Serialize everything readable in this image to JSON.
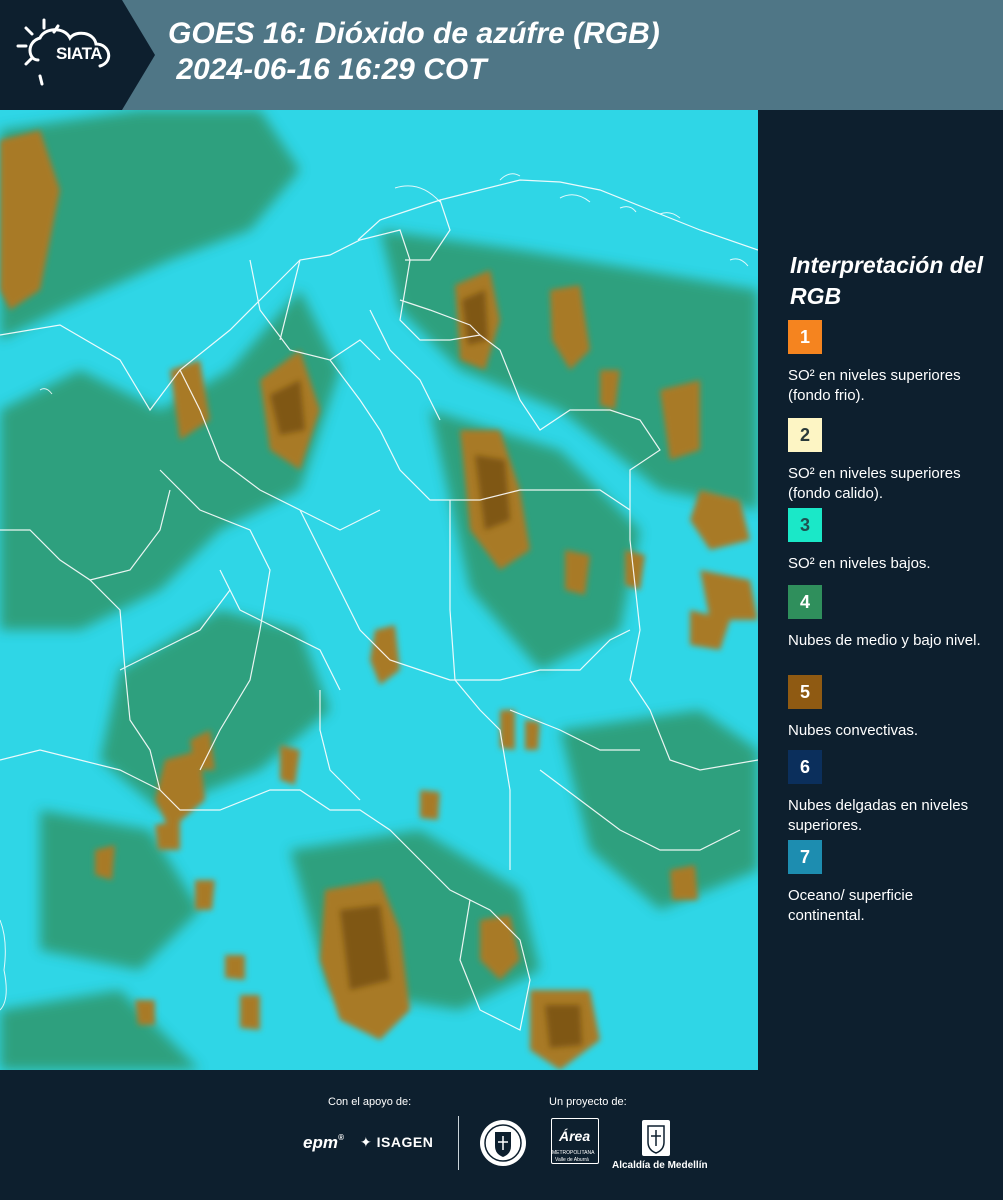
{
  "header": {
    "logo_text": "SIATA",
    "title_line1": "GOES 16: Dióxido de azúfre (RGB)",
    "title_line2": " 2024-06-16 16:29 COT"
  },
  "map": {
    "background_color": "#2fd6e6",
    "border_color": "#ffffff"
  },
  "legend": {
    "title": "Interpretación del RGB",
    "items": [
      {
        "number": "1",
        "label": "SO² en niveles superiores (fondo frio).",
        "color": "#f5841f",
        "number_color": "#ffffff"
      },
      {
        "number": "2",
        "label": "SO² en niveles superiores (fondo calido).",
        "color": "#fdf5c4",
        "number_color": "#2a3a3a"
      },
      {
        "number": "3",
        "label": "SO² en niveles bajos.",
        "color": "#1ae8c8",
        "number_color": "#1f5050"
      },
      {
        "number": "4",
        "label": "Nubes de medio y bajo nivel.",
        "color": "#2f8f5c",
        "number_color": "#ffffff"
      },
      {
        "number": "5",
        "label": "Nubes convectivas.",
        "color": "#8f5a12",
        "number_color": "#ffffff"
      },
      {
        "number": "6",
        "label": "Nubes delgadas en niveles superiores.",
        "color": "#0b2f5c",
        "number_color": "#ffffff"
      },
      {
        "number": "7",
        "label": "Oceano/ superficie continental.",
        "color": "#1d8db0",
        "number_color": "#ffffff"
      }
    ]
  },
  "footer": {
    "support_caption": "Con el apoyo de:",
    "project_caption": "Un proyecto de:",
    "logos": {
      "epm": "epm",
      "isagen": "ISAGEN",
      "area": "Área",
      "area_sub": "METROPOLITANA",
      "area_sub2": "Valle de Aburrá",
      "alcaldia": "Alcaldía de Medellín"
    }
  }
}
